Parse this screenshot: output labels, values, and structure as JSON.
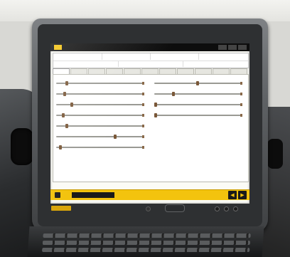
{
  "scene": {
    "description_free": true
  },
  "app": {
    "title": "",
    "accent_color": "#f3c30e"
  },
  "header": {
    "row1": [
      "",
      "",
      "",
      ""
    ],
    "row2": [
      "",
      "",
      ""
    ]
  },
  "tabs": [
    {
      "label": "",
      "active": true
    },
    {
      "label": "",
      "active": false
    },
    {
      "label": "",
      "active": false
    },
    {
      "label": "",
      "active": false
    },
    {
      "label": "",
      "active": false
    },
    {
      "label": "",
      "active": false
    },
    {
      "label": "",
      "active": false
    },
    {
      "label": "",
      "active": false
    },
    {
      "label": "",
      "active": false
    },
    {
      "label": "",
      "active": false
    },
    {
      "label": "",
      "active": false
    }
  ],
  "parameters_left": [
    {
      "label": "",
      "level": 0.12
    },
    {
      "label": "",
      "level": 0.1
    },
    {
      "label": "",
      "level": 0.18
    },
    {
      "label": "",
      "level": 0.08
    },
    {
      "label": "",
      "level": 0.12
    },
    {
      "label": "",
      "level": 0.68
    },
    {
      "label": "",
      "level": 0.05
    }
  ],
  "parameters_right": [
    {
      "label": "",
      "level": 0.5
    },
    {
      "label": "",
      "level": 0.22
    },
    {
      "label": "",
      "level": 0.02
    },
    {
      "label": "",
      "level": 0.02
    }
  ],
  "statusbar": {
    "field_text": "",
    "buttons": [
      "◀",
      "▶"
    ]
  }
}
